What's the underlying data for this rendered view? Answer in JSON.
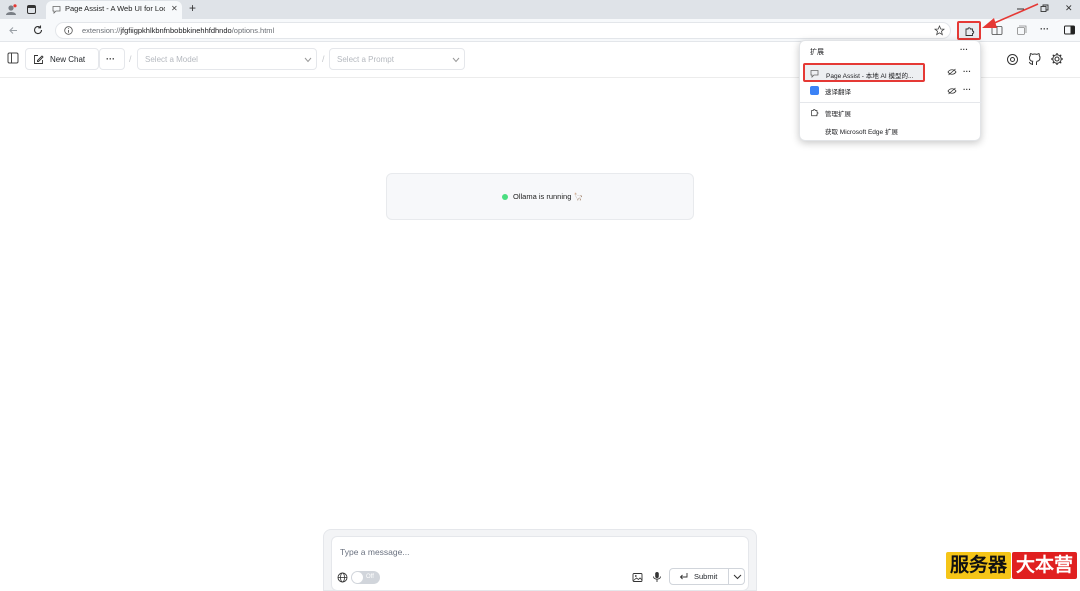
{
  "browser": {
    "tab_title": "Page Assist - A Web UI for Local AI",
    "url_prefix": "extension://",
    "url_host": "jfgfiigpkhlkbnfnbobbkinehhfdhndo",
    "url_path": "/options.html",
    "new_tab_symbol": "+"
  },
  "toolbar": {
    "new_chat_label": "New Chat",
    "more_symbol": "···",
    "separator": "/",
    "model_placeholder": "Select a Model",
    "prompt_placeholder": "Select a Prompt"
  },
  "status": {
    "text": "Ollama is running 🦙",
    "dot_color": "#4ade80"
  },
  "extensions_popup": {
    "title": "扩展",
    "items": [
      {
        "label": "Page Assist - 本地 AI 模型的..."
      },
      {
        "label": "速译翻译"
      }
    ],
    "manage_label": "管理扩展",
    "get_label": "获取 Microsoft Edge 扩展",
    "more_symbol": "···"
  },
  "composer": {
    "placeholder": "Type a message...",
    "toggle_label": "Off",
    "submit_label": "Submit"
  },
  "watermark": {
    "left": "服务器",
    "right": "大本营"
  },
  "colors": {
    "highlight": "#e53935",
    "accent": "#4ade80"
  }
}
